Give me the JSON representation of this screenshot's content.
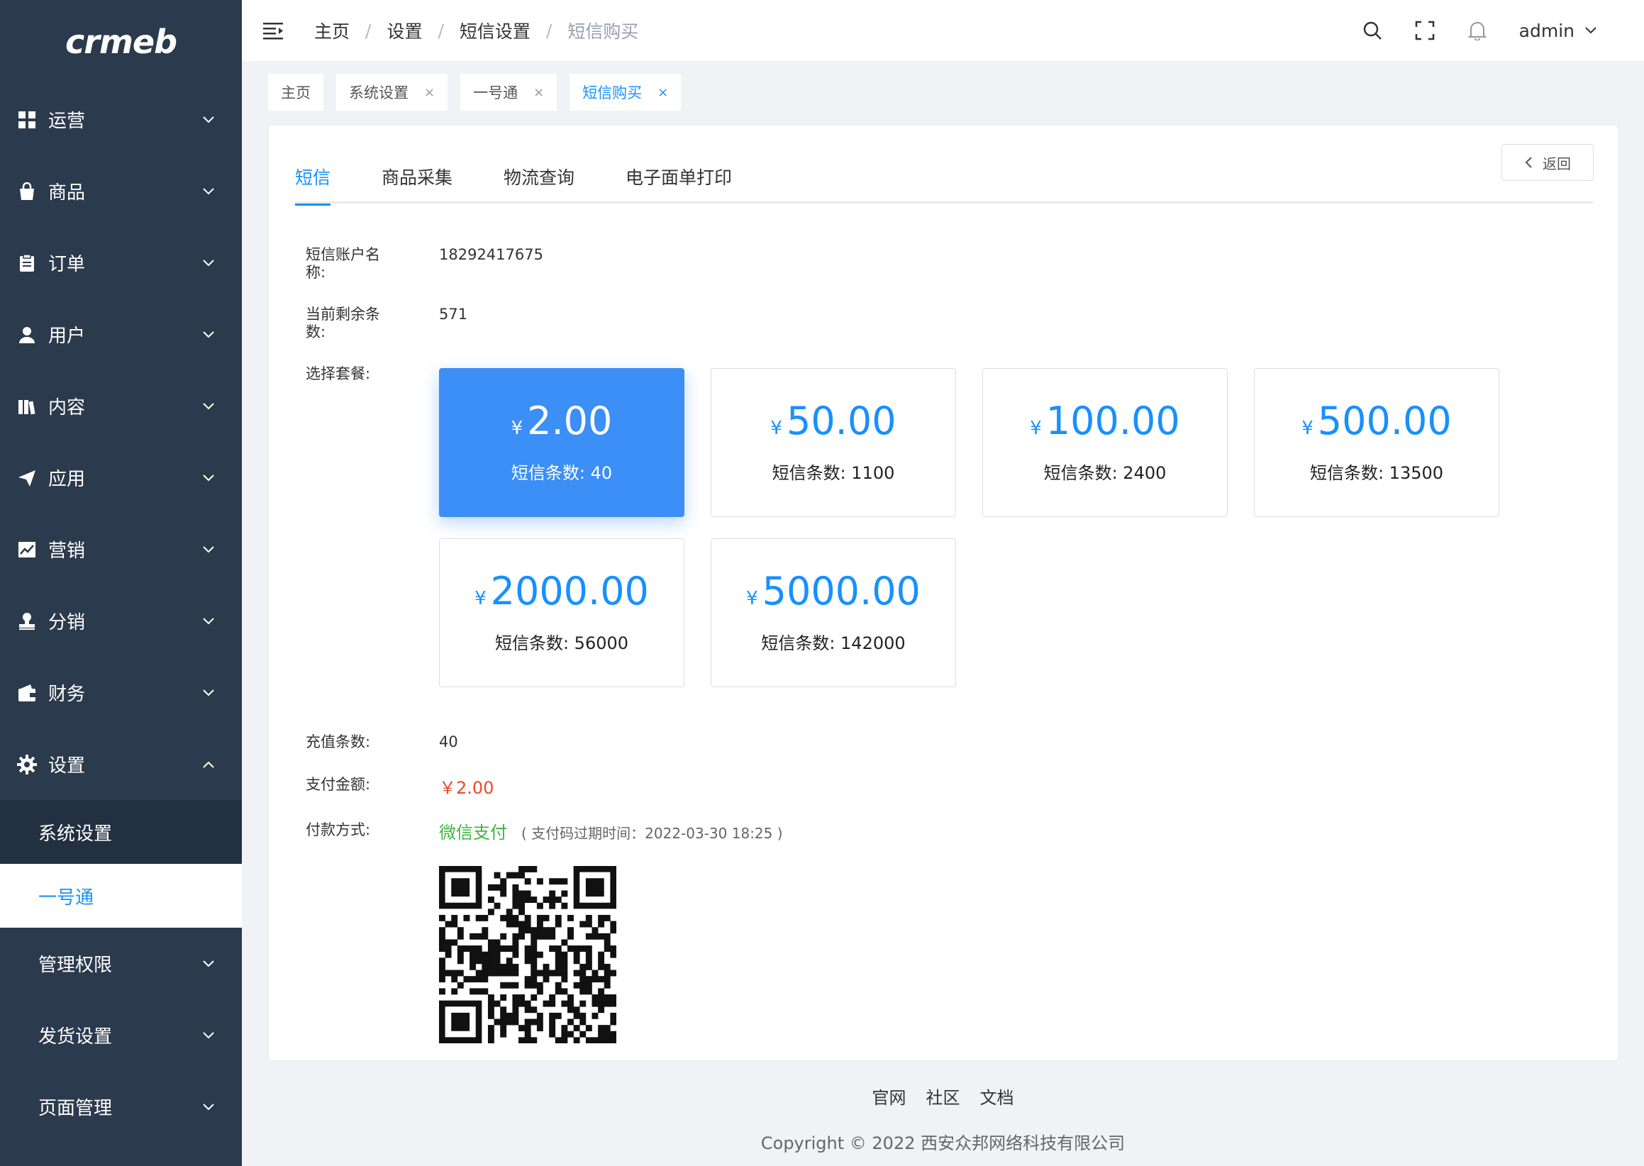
{
  "logo": "crmeb",
  "sidebar": {
    "items": [
      {
        "label": "运营",
        "icon": "grid-icon"
      },
      {
        "label": "商品",
        "icon": "bag-icon"
      },
      {
        "label": "订单",
        "icon": "clipboard-icon"
      },
      {
        "label": "用户",
        "icon": "user-icon"
      },
      {
        "label": "内容",
        "icon": "book-icon"
      },
      {
        "label": "应用",
        "icon": "send-icon"
      },
      {
        "label": "营销",
        "icon": "chart-icon"
      },
      {
        "label": "分销",
        "icon": "stamp-icon"
      },
      {
        "label": "财务",
        "icon": "wallet-icon"
      },
      {
        "label": "设置",
        "icon": "gear-icon"
      }
    ],
    "sub_items": [
      {
        "label": "系统设置"
      },
      {
        "label": "一号通"
      }
    ],
    "more_items": [
      {
        "label": "管理权限"
      },
      {
        "label": "发货设置"
      },
      {
        "label": "页面管理"
      }
    ]
  },
  "header": {
    "breadcrumb": [
      "主页",
      "设置",
      "短信设置",
      "短信购买"
    ],
    "user": "admin"
  },
  "tags": [
    {
      "label": "主页"
    },
    {
      "label": "系统设置",
      "close": "×"
    },
    {
      "label": "一号通",
      "close": "×"
    },
    {
      "label": "短信购买",
      "close": "×"
    }
  ],
  "main": {
    "back_label": "返回",
    "tabs": [
      "短信",
      "商品采集",
      "物流查询",
      "电子面单打印"
    ],
    "account_label": "短信账户名称:",
    "account_value": "18292417675",
    "remaining_label": "当前剩余条数:",
    "remaining_value": "571",
    "package_label": "选择套餐:",
    "packages": [
      {
        "price": "2.00",
        "count": "短信条数: 40"
      },
      {
        "price": "50.00",
        "count": "短信条数: 1100"
      },
      {
        "price": "100.00",
        "count": "短信条数: 2400"
      },
      {
        "price": "500.00",
        "count": "短信条数: 13500"
      },
      {
        "price": "2000.00",
        "count": "短信条数: 56000"
      },
      {
        "price": "5000.00",
        "count": "短信条数: 142000"
      }
    ],
    "currency": "¥",
    "recharge_label": "充值条数:",
    "recharge_value": "40",
    "pay_amount_label": "支付金额:",
    "pay_amount_value": "￥2.00",
    "pay_method_label": "付款方式:",
    "pay_method_value": "微信支付",
    "pay_expire": "( 支付码过期时间：2022-03-30 18:25 )"
  },
  "footer": {
    "links": [
      "官网",
      "社区",
      "文档"
    ],
    "copyright": "Copyright © 2022 西安众邦网络科技有限公司"
  },
  "colors": {
    "sidebar_bg": "#2c3a4d",
    "accent": "#1890ff",
    "selected_pkg": "#3b8ff6",
    "amount": "#e94a2b",
    "wechat": "#3fb53f"
  }
}
